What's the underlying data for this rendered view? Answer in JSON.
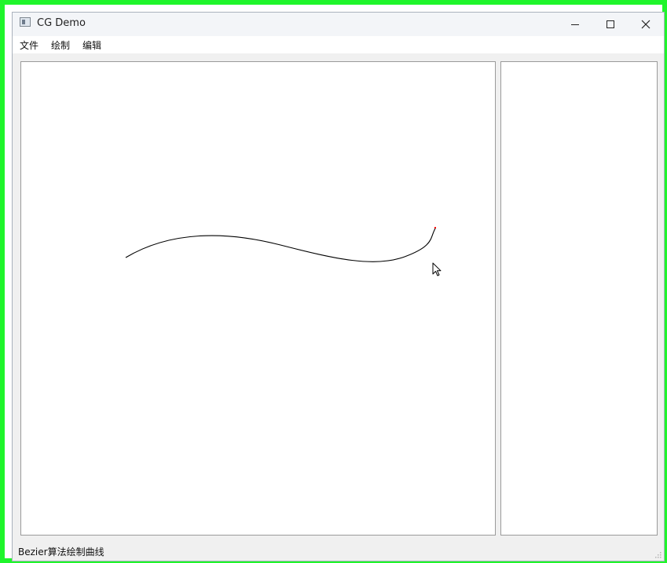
{
  "window": {
    "title": "CG Demo",
    "icon": "app-window-icon",
    "controls": {
      "minimize_icon": "minimize-icon",
      "maximize_icon": "maximize-icon",
      "close_icon": "close-icon"
    }
  },
  "menubar": {
    "items": [
      {
        "label": "文件"
      },
      {
        "label": "绘制"
      },
      {
        "label": "编辑"
      }
    ]
  },
  "canvas": {
    "curve_type": "bezier",
    "curve_color": "#000000",
    "endpoint_marker_color": "#ff0000",
    "cursor_icon": "mouse-pointer-icon"
  },
  "statusbar": {
    "message": "Bezier算法绘制曲线",
    "grip_icon": "size-grip-icon"
  },
  "colors": {
    "frame_border": "#1ff52b",
    "window_background": "#f0f0f0",
    "panel_background": "#ffffff",
    "panel_border": "#9a9a9a"
  }
}
